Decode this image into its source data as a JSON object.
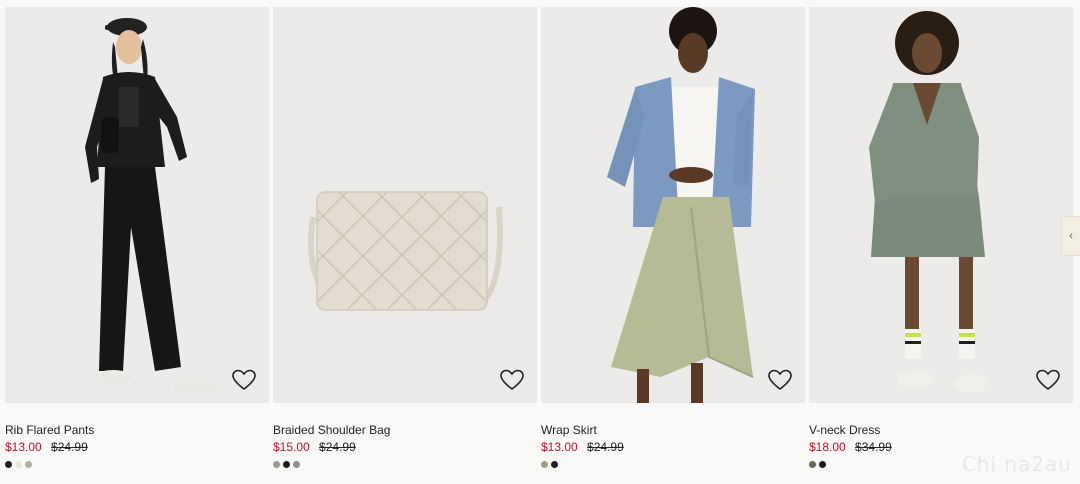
{
  "products": [
    {
      "name": "Rib Flared Pants",
      "sale_price": "$13.00",
      "original_price": "$24.99",
      "swatches": [
        "#1e1e1e",
        "#ebe7dc",
        "#a9b3a2"
      ]
    },
    {
      "name": "Braided Shoulder Bag",
      "sale_price": "$15.00",
      "original_price": "$24.99",
      "swatches": [
        "#9d9a92",
        "#1e1e1e",
        "#8f8f8f"
      ]
    },
    {
      "name": "Wrap Skirt",
      "sale_price": "$13.00",
      "original_price": "$24.99",
      "swatches": [
        "#9ca07f",
        "#1e1e1e"
      ]
    },
    {
      "name": "V-neck Dress",
      "sale_price": "$18.00",
      "original_price": "$34.99",
      "swatches": [
        "#5e6b5c",
        "#1e1e1e"
      ]
    }
  ],
  "favorite_icon": "heart-outline-icon",
  "next_arrow_label": "‹",
  "watermark": "Chi na2au",
  "colors": {
    "sale": "#c8102e",
    "text": "#222222",
    "page_background": "#faf9f8"
  }
}
